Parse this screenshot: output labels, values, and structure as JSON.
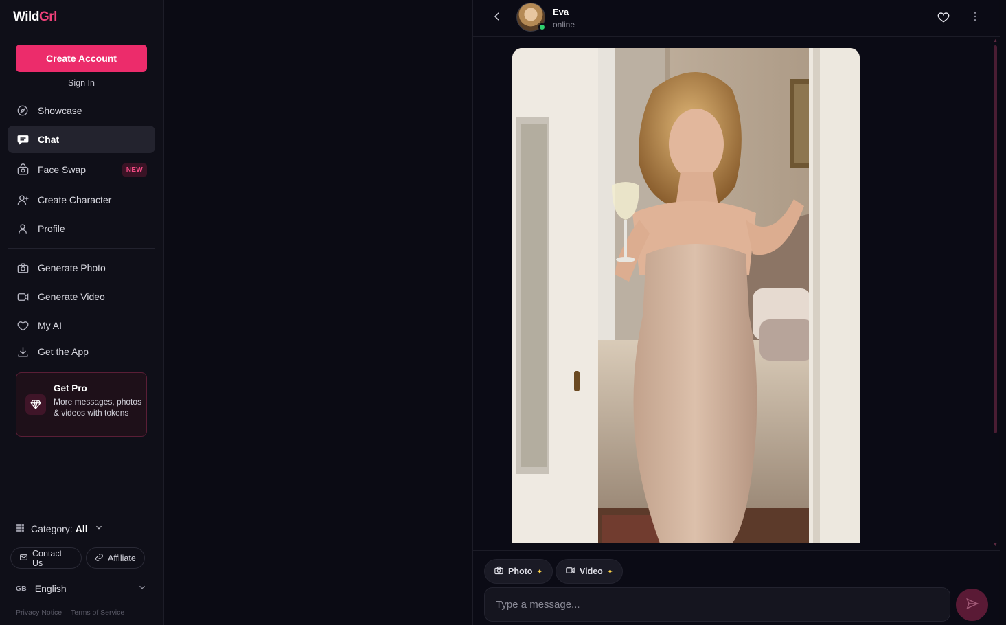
{
  "brand": {
    "name_part1": "Wild",
    "name_part2": "Grl",
    "accent": "#ec2c6b"
  },
  "sidebar": {
    "create_account": "Create Account",
    "sign_in": "Sign In",
    "nav_primary": [
      {
        "label": "Showcase",
        "icon": "compass-icon"
      },
      {
        "label": "Chat",
        "icon": "chat-bubble-icon",
        "active": true
      },
      {
        "label": "Face Swap",
        "icon": "face-swap-icon",
        "badge": "NEW"
      },
      {
        "label": "Create Character",
        "icon": "user-plus-icon"
      },
      {
        "label": "Profile",
        "icon": "user-icon"
      }
    ],
    "nav_secondary": [
      {
        "label": "Generate Photo",
        "icon": "camera-icon"
      },
      {
        "label": "Generate Video",
        "icon": "video-icon"
      },
      {
        "label": "My AI",
        "icon": "heart-icon"
      },
      {
        "label": "Get the App",
        "icon": "download-icon"
      }
    ],
    "pro": {
      "title": "Get Pro",
      "description": "More messages, photos & videos with tokens"
    },
    "category": {
      "label": "Category:",
      "value": "All"
    },
    "contact": "Contact Us",
    "affiliate": "Affiliate",
    "language": {
      "flag": "GB",
      "value": "English"
    },
    "privacy": "Privacy Notice",
    "terms": "Terms of Service"
  },
  "chat": {
    "name": "Eva",
    "status": "online",
    "chips": {
      "photo": "Photo",
      "video": "Video"
    },
    "input_placeholder": "Type a message..."
  }
}
